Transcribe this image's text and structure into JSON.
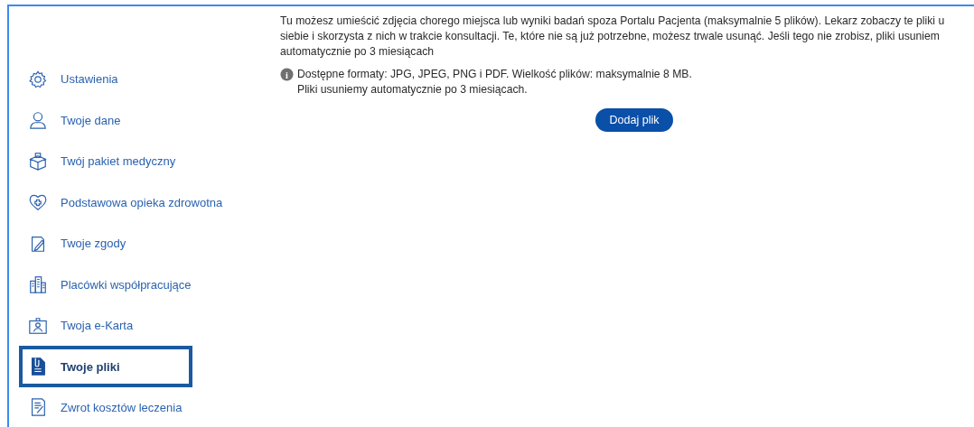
{
  "sidebar": {
    "items": [
      {
        "kind": "gear",
        "label": "Ustawienia",
        "selected": false
      },
      {
        "kind": "person",
        "label": "Twoje dane",
        "selected": false
      },
      {
        "kind": "package",
        "label": "Twój pakiet medyczny",
        "selected": false
      },
      {
        "kind": "heart",
        "label": "Podstawowa opieka zdrowotna",
        "selected": false
      },
      {
        "kind": "pen",
        "label": "Twoje zgody",
        "selected": false
      },
      {
        "kind": "buildings",
        "label": "Placówki współpracujące",
        "selected": false
      },
      {
        "kind": "badge",
        "label": "Twoja e-Karta",
        "selected": false
      },
      {
        "kind": "file",
        "label": "Twoje pliki",
        "selected": true
      },
      {
        "kind": "receipt",
        "label": "Zwrot kosztów leczenia",
        "selected": false
      }
    ]
  },
  "content": {
    "description_lines": [
      "Tu możesz umieścić zdjęcia chorego miejsca lub wyniki badań spoza Portalu Pacjenta (maksymalnie 5 plików). Lekarz zobaczy te pliki u",
      "siebie i skorzysta z nich w trakcie konsultacji. Te, które nie są już potrzebne, możesz trwale usunąć. Jeśli tego nie zrobisz, pliki usuniem",
      "automatycznie po 3 miesiącach"
    ],
    "info": {
      "icon": "i",
      "lines": [
        "Dostępne formaty: JPG, JPEG, PNG i PDF. Wielkość plików: maksymalnie 8 MB.",
        "Pliki usuniemy automatycznie po 3 miesiącach."
      ]
    },
    "button": "Dodaj plik"
  }
}
